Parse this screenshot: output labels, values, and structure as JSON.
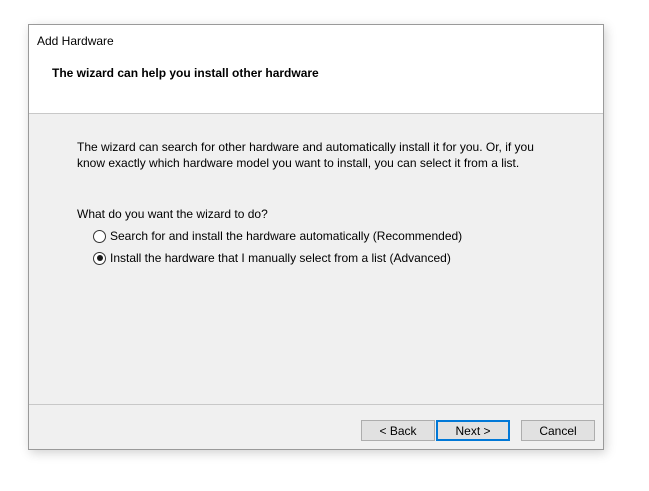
{
  "window": {
    "title": "Add Hardware"
  },
  "header": {
    "heading": "The wizard can help you install other hardware"
  },
  "body": {
    "description": "The wizard can search for other hardware and automatically install it for you. Or, if you know exactly which hardware model you want to install, you can select it from a list.",
    "question": "What do you want the wizard to do?",
    "options": [
      {
        "label": "Search for and install the hardware automatically (Recommended)",
        "selected": false
      },
      {
        "label": "Install the hardware that I manually select from a list (Advanced)",
        "selected": true
      }
    ]
  },
  "footer": {
    "back_label": "< Back",
    "next_label": "Next >",
    "cancel_label": "Cancel"
  },
  "colors": {
    "dialog_background": "#f0f0f0",
    "header_background": "#ffffff",
    "default_button_border": "#0078d7"
  }
}
